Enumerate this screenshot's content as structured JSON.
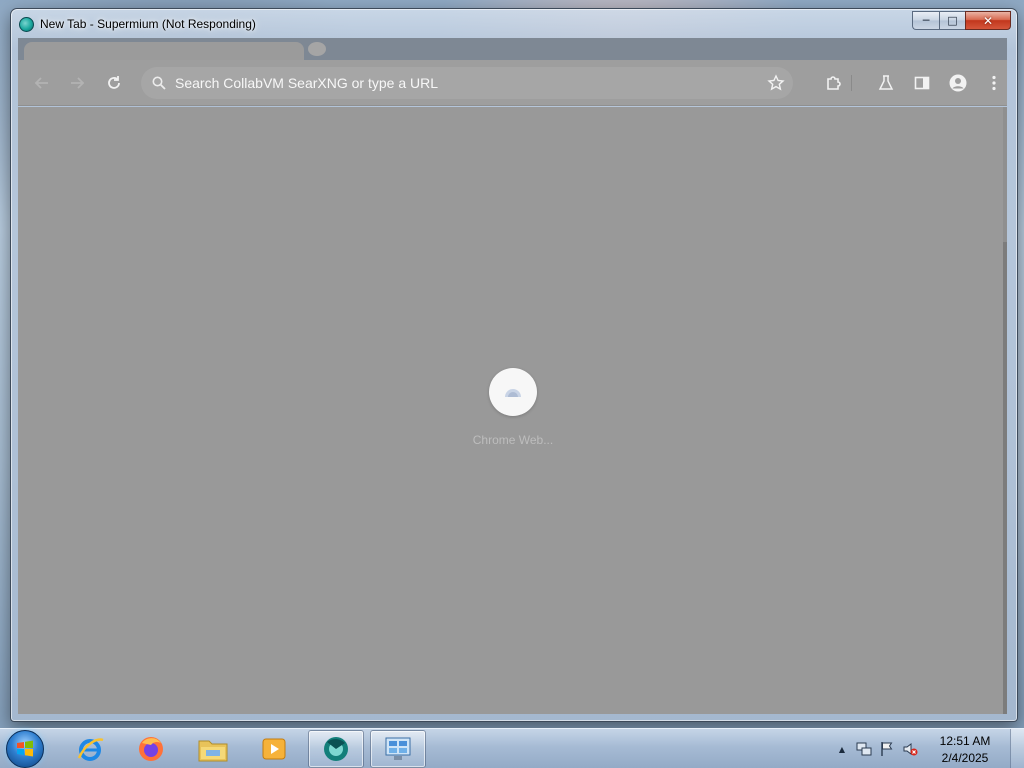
{
  "window": {
    "title": "New Tab - Supermium (Not Responding)",
    "caption": {
      "minimize": "─",
      "maximize": "□",
      "close": "✕"
    }
  },
  "toolbar": {
    "back_icon": "back-arrow-icon",
    "forward_icon": "forward-arrow-icon",
    "reload_icon": "reload-icon",
    "omnibox_placeholder": "Search CollabVM SearXNG or type a URL",
    "bookmark_icon": "star-icon",
    "extensions_icon": "puzzle-icon",
    "labs_icon": "flask-icon",
    "side_panel_icon": "side-panel-icon",
    "profile_icon": "avatar-icon",
    "menu_icon": "kebab-menu-icon"
  },
  "content": {
    "loading_label": "Chrome Web..."
  },
  "taskbar": {
    "apps": [
      {
        "name": "internet-explorer",
        "icon": "ie-icon"
      },
      {
        "name": "firefox",
        "icon": "firefox-icon"
      },
      {
        "name": "file-explorer",
        "icon": "folder-icon"
      },
      {
        "name": "media-player",
        "icon": "media-player-icon"
      },
      {
        "name": "supermium",
        "icon": "supermium-icon",
        "active": true
      },
      {
        "name": "control-panel",
        "icon": "control-panel-icon"
      }
    ],
    "tray": {
      "show_hidden": "▲",
      "time": "12:51 AM",
      "date": "2/4/2025"
    }
  },
  "colors": {
    "content_bg": "#999999",
    "toolbar_bg": "#9e9e9e",
    "omnibox_bg": "#a6a6a6",
    "close_button": "#c7432a"
  }
}
